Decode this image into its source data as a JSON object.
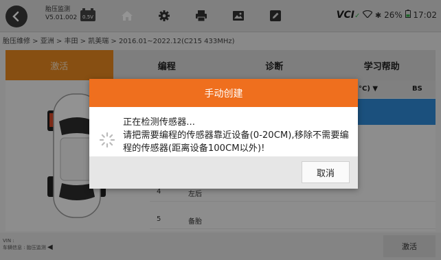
{
  "header": {
    "app_name": "胎压监测",
    "app_version": "V5.01.002",
    "battery_voltage": "0.5V",
    "vci_label": "VCI",
    "battery_percent": "26%",
    "clock": "17:02"
  },
  "breadcrumb": "胎压维修 > 亚洲 > 丰田 > 凯美瑞 > 2016.01~2022.12(C215 433MHz)",
  "tabs": [
    {
      "label": "激活",
      "active": true
    },
    {
      "label": "编程",
      "active": false
    },
    {
      "label": "诊断",
      "active": false
    },
    {
      "label": "学习帮助",
      "active": false
    }
  ],
  "table": {
    "header_temp": "°C) ▼",
    "header_bs": "BS",
    "rows": [
      {
        "num": "4",
        "pos": "左后"
      },
      {
        "num": "5",
        "pos": "备胎"
      }
    ]
  },
  "footer": {
    "vin_label": "VIN :",
    "vehicle_info": "车辆信息 : 胎压监测",
    "activate_label": "激活"
  },
  "dialog": {
    "title": "手动创建",
    "line1": "正在检测传感器...",
    "line2": "请把需要编程的传感器靠近设备(0-20CM),移除不需要编程的传感器(距离设备100CM以外)!",
    "cancel_label": "取消"
  },
  "colors": {
    "accent_orange": "#ef6f1e",
    "tab_active": "#e8891f",
    "selection_blue": "#2f8ad8"
  },
  "icons": [
    "back-icon",
    "home-icon",
    "gear-icon",
    "printer-icon",
    "image-icon",
    "edit-icon",
    "wifi-icon",
    "bluetooth-icon",
    "battery-icon",
    "spinner-icon",
    "car-icon"
  ]
}
